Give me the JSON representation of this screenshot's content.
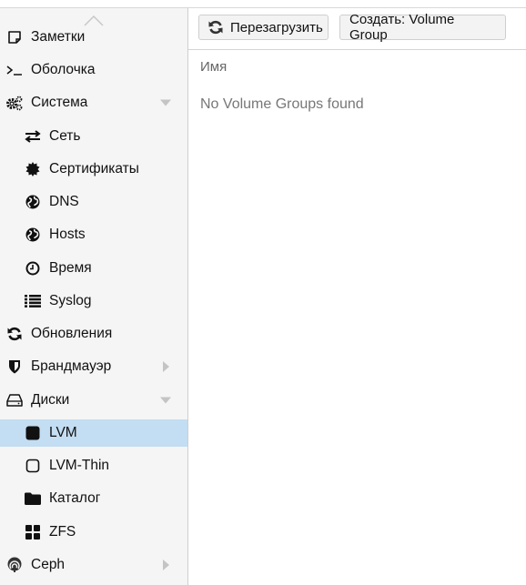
{
  "sidebar": {
    "items": [
      {
        "label": "Заметки",
        "icon": "note-icon",
        "level": 0
      },
      {
        "label": "Оболочка",
        "icon": "terminal-icon",
        "level": 0
      },
      {
        "label": "Система",
        "icon": "gears-icon",
        "level": 0,
        "expander": "expanded"
      },
      {
        "label": "Сеть",
        "icon": "exchange-icon",
        "level": 1
      },
      {
        "label": "Сертификаты",
        "icon": "certificate-icon",
        "level": 1
      },
      {
        "label": "DNS",
        "icon": "globe-icon",
        "level": 1
      },
      {
        "label": "Hosts",
        "icon": "globe-icon",
        "level": 1
      },
      {
        "label": "Время",
        "icon": "clock-icon",
        "level": 1
      },
      {
        "label": "Syslog",
        "icon": "list-icon",
        "level": 1
      },
      {
        "label": "Обновления",
        "icon": "refresh-icon",
        "level": 0
      },
      {
        "label": "Брандмауэр",
        "icon": "shield-icon",
        "level": 0,
        "expander": "collapsed"
      },
      {
        "label": "Диски",
        "icon": "hdd-icon",
        "level": 0,
        "expander": "expanded"
      },
      {
        "label": "LVM",
        "icon": "square-icon",
        "level": 1,
        "selected": true
      },
      {
        "label": "LVM-Thin",
        "icon": "square-outline-icon",
        "level": 1
      },
      {
        "label": "Каталог",
        "icon": "folder-icon",
        "level": 1
      },
      {
        "label": "ZFS",
        "icon": "th-large-icon",
        "level": 1
      },
      {
        "label": "Ceph",
        "icon": "ceph-icon",
        "level": 0,
        "expander": "collapsed"
      }
    ]
  },
  "toolbar": {
    "reload_label": "Перезагрузить",
    "create_label": "Создать: Volume Group"
  },
  "grid": {
    "column_name": "Имя",
    "empty_text": "No Volume Groups found"
  },
  "colors": {
    "selected_bg": "#c3ddf2",
    "sidebar_bg": "#f5f5f5"
  }
}
